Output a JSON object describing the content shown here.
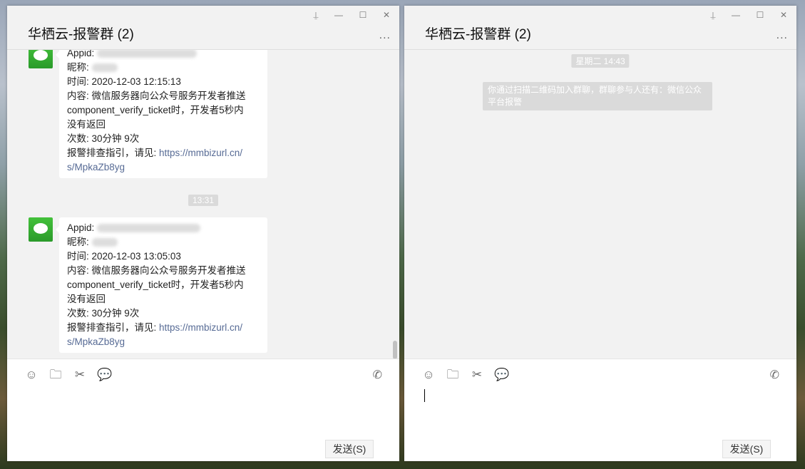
{
  "windows": [
    {
      "title": "华栖云-报警群 (2)",
      "more": "...",
      "send": "发送(S)",
      "messages": [
        {
          "appid_label": "Appid:",
          "nick_label": "昵称:",
          "time": "时间: 2020-12-03 12:15:13",
          "content1": "内容: 微信服务器向公众号服务开发者推送",
          "content2": "component_verify_ticket时，开发者5秒内",
          "content3": "没有返回",
          "count": "次数: 30分钟 9次",
          "guide": "报警排查指引，请见: ",
          "link1": "https://mmbizurl.cn/",
          "link2": "s/MpkaZb8yg"
        },
        {
          "appid_label": "Appid:",
          "nick_label": "昵称:",
          "time": "时间: 2020-12-03 13:05:03",
          "content1": "内容: 微信服务器向公众号服务开发者推送",
          "content2": "component_verify_ticket时，开发者5秒内",
          "content3": "没有返回",
          "count": "次数: 30分钟 9次",
          "guide": "报警排查指引，请见: ",
          "link1": "https://mmbizurl.cn/",
          "link2": "s/MpkaZb8yg"
        }
      ],
      "time_separator": "13:31"
    },
    {
      "title": "华栖云-报警群 (2)",
      "more": "...",
      "send": "发送(S)",
      "time_separator": "星期二 14:43",
      "system_message": "你通过扫描二维码加入群聊，群聊参与人还有：微信公众平台报警"
    }
  ],
  "window_controls": {
    "pin": "⍊",
    "minimize": "—",
    "maximize": "☐",
    "close": "✕"
  },
  "icons": {
    "emoji": "☺",
    "folder": "🗀",
    "scissors": "✂",
    "chat": "💬",
    "call": "✆"
  }
}
